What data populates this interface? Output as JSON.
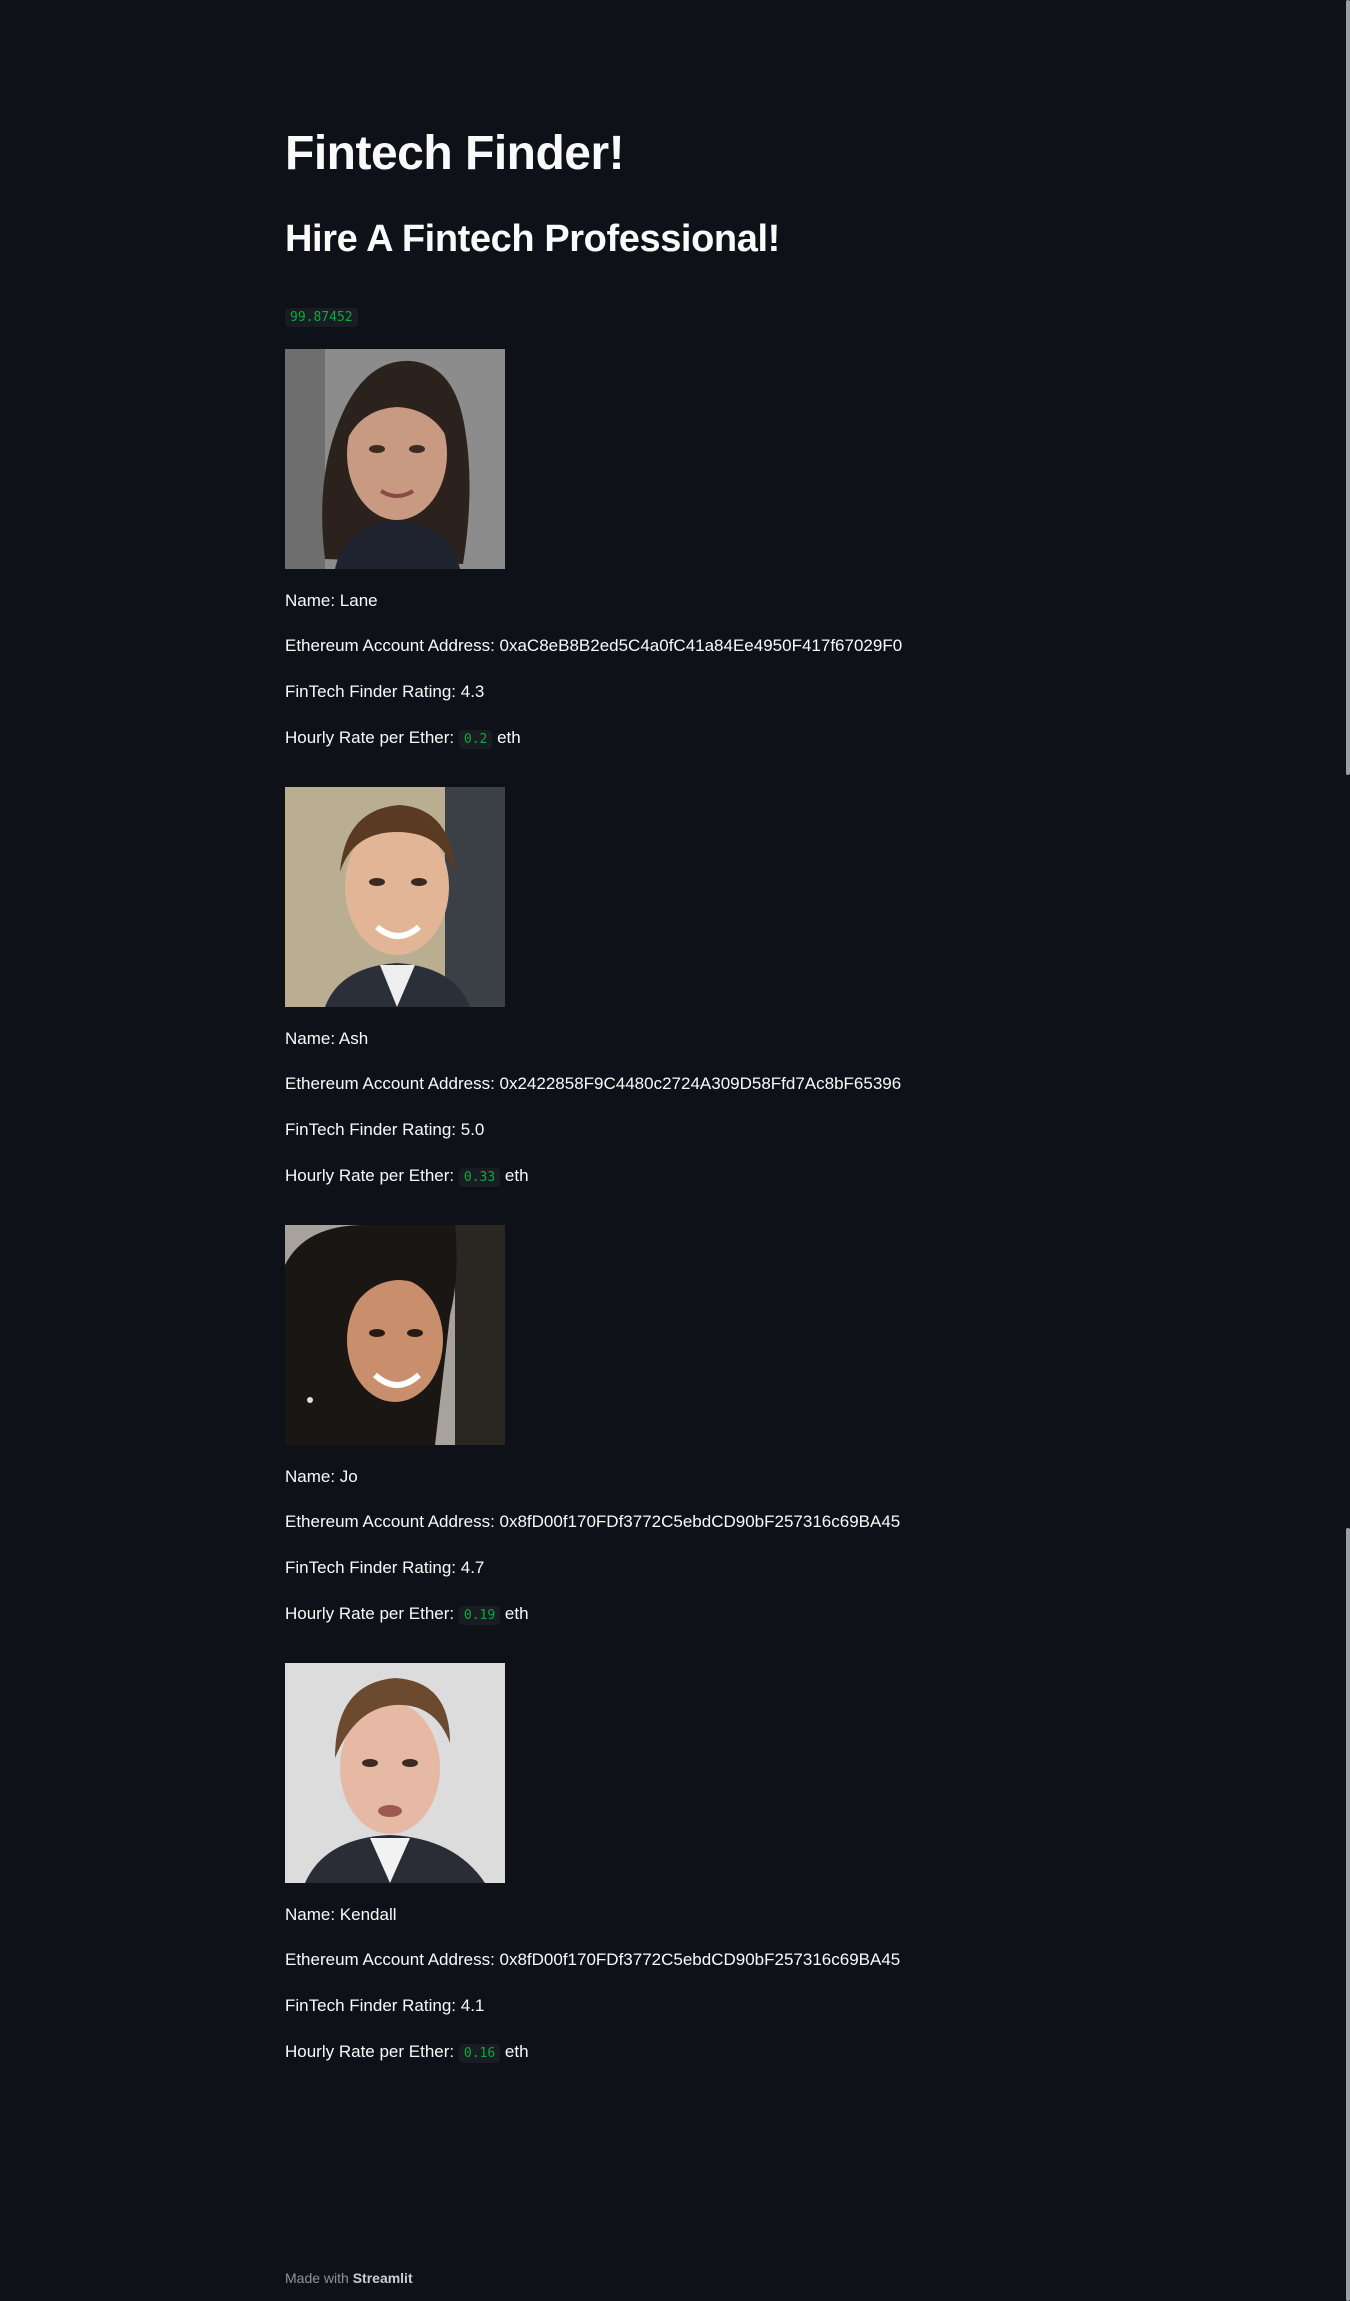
{
  "header": {
    "title": "Fintech Finder!",
    "subtitle": "Hire A Fintech Professional!",
    "balance": "99.87452"
  },
  "candidates": [
    {
      "name_line": "Name: Lane",
      "address_line": "Ethereum Account Address: 0xaC8eB8B2ed5C4a0fC41a84Ee4950F417f67029F0",
      "rating_line": "FinTech Finder Rating: 4.3",
      "rate_label": "Hourly Rate per Ether:",
      "rate_value": "0.2",
      "rate_unit": "eth"
    },
    {
      "name_line": "Name: Ash",
      "address_line": "Ethereum Account Address: 0x2422858F9C4480c2724A309D58Ffd7Ac8bF65396",
      "rating_line": "FinTech Finder Rating: 5.0",
      "rate_label": "Hourly Rate per Ether:",
      "rate_value": "0.33",
      "rate_unit": "eth"
    },
    {
      "name_line": "Name: Jo",
      "address_line": "Ethereum Account Address: 0x8fD00f170FDf3772C5ebdCD90bF257316c69BA45",
      "rating_line": "FinTech Finder Rating: 4.7",
      "rate_label": "Hourly Rate per Ether:",
      "rate_value": "0.19",
      "rate_unit": "eth"
    },
    {
      "name_line": "Name: Kendall",
      "address_line": "Ethereum Account Address: 0x8fD00f170FDf3772C5ebdCD90bF257316c69BA45",
      "rating_line": "FinTech Finder Rating: 4.1",
      "rate_label": "Hourly Rate per Ether:",
      "rate_value": "0.16",
      "rate_unit": "eth"
    }
  ],
  "footer": {
    "prefix": "Made with",
    "brand": "Streamlit"
  }
}
